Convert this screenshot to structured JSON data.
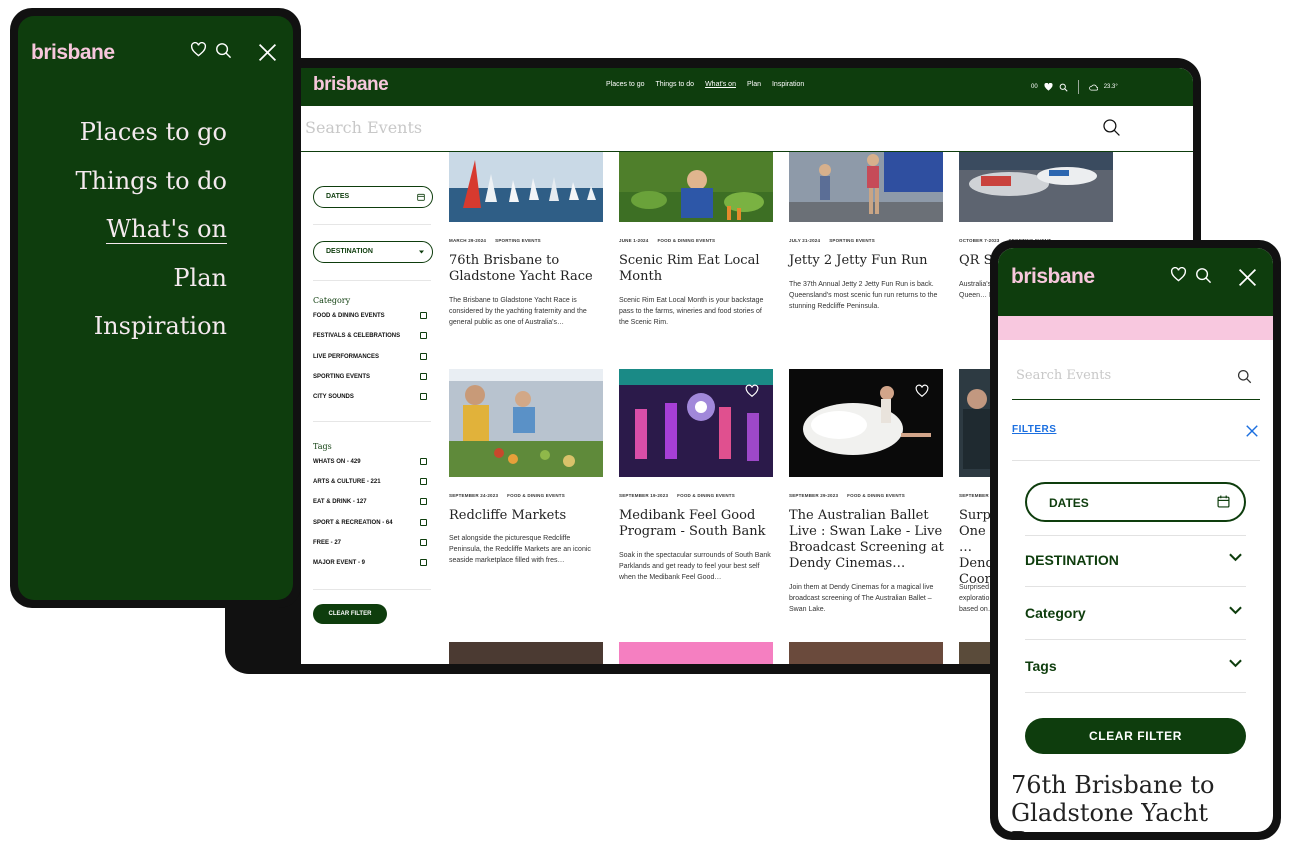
{
  "brand": {
    "logo": "brisbane",
    "logo_color": "#f7c7dc",
    "primary_green": "#0e3d0d",
    "accent_pink": "#f8c8df"
  },
  "tablet": {
    "nav": [
      "Places to go",
      "Things to do",
      "What's on",
      "Plan",
      "Inspiration"
    ],
    "active_nav": "What's on",
    "tools": {
      "favourites_count": "00",
      "weather": "23.3°"
    },
    "search_placeholder": "Search Events",
    "sidebar": {
      "dates_label": "DATES",
      "destination_label": "DESTINATION",
      "category_title": "Category",
      "categories": [
        "FOOD & DINING EVENTS",
        "FESTIVALS & CELEBRATIONS",
        "LIVE PERFORMANCES",
        "SPORTING EVENTS",
        "CITY SOUNDS"
      ],
      "tags_title": "Tags",
      "tags": [
        "WHATS ON - 429",
        "ARTS & CULTURE - 221",
        "EAT & DRINK - 127",
        "SPORT & RECREATION - 64",
        "FREE - 27",
        "MAJOR EVENT - 9"
      ],
      "clear_label": "CLEAR FILTER"
    },
    "cards": [
      {
        "date": "MARCH 29-2024",
        "category": "SPORTING EVENTS",
        "title": "76th Brisbane to Gladstone Yacht Race",
        "desc": "The Brisbane to Gladstone Yacht Race is considered by the yachting fraternity and the general public as one of Australia's…",
        "image": "yachts-image"
      },
      {
        "date": "JUNE 1-2024",
        "category": "FOOD & DINING EVENTS",
        "title": "Scenic Rim Eat Local Month",
        "desc": "Scenic Rim Eat Local Month is your backstage pass to the farms, wineries and food stories of the Scenic Rim.",
        "image": "farm-image"
      },
      {
        "date": "JULY 21-2024",
        "category": "SPORTING EVENTS",
        "title": "Jetty 2 Jetty Fun Run",
        "desc": "The 37th Annual Jetty 2 Jetty Fun Run is back. Queensland's most scenic fun run returns to the stunning Redcliffe Peninsula.",
        "image": "run-image"
      },
      {
        "date": "OCTOBER 7-2023",
        "category": "SPORTING EVENT",
        "title": "QR Sy",
        "desc": "Australia's … by Queen… Raceway…",
        "image": "drift-image"
      },
      {
        "date": "SEPTEMBER 24-2023",
        "category": "FOOD & DINING EVENTS",
        "title": "Redcliffe Markets",
        "desc": "Set alongside the picturesque Redcliffe Peninsula, the Redcliffe Markets are an iconic seaside marketplace filled with fres…",
        "image": "market-image"
      },
      {
        "date": "SEPTEMBER 19-2023",
        "category": "FOOD & DINING EVENTS",
        "title": "Medibank Feel Good Program - South Bank",
        "desc": "Soak in the spectacular surrounds of South Bank Parklands and get ready to feel your best self when the Medibank Feel Good…",
        "image": "dance-image"
      },
      {
        "date": "SEPTEMBER 29-2023",
        "category": "FOOD & DINING EVENTS",
        "title": "The Australian Ballet Live : Swan Lake - Live Broadcast Screening at Dendy Cinemas…",
        "desc": "Join them at Dendy Cinemas for a magical live broadcast screening of The Australian Ballet – Swan Lake.",
        "image": "ballet-image"
      },
      {
        "date": "SEPTEMBER 2…",
        "category": "",
        "title": "Surp… One … Dend… Coor…",
        "desc": "Surprised… exploratio… based on…",
        "image": "portrait-image"
      }
    ]
  },
  "phone_menu": {
    "items": [
      "Places to go",
      "Things to do",
      "What's on",
      "Plan",
      "Inspiration"
    ],
    "active": "What's on"
  },
  "phone_filters": {
    "search_placeholder": "Search Events",
    "filters_label": "FILTERS",
    "dates_label": "DATES",
    "accordions": [
      "DESTINATION",
      "Category",
      "Tags"
    ],
    "clear_label": "CLEAR FILTER",
    "peek_title": "76th Brisbane to Gladstone Yacht Race"
  }
}
